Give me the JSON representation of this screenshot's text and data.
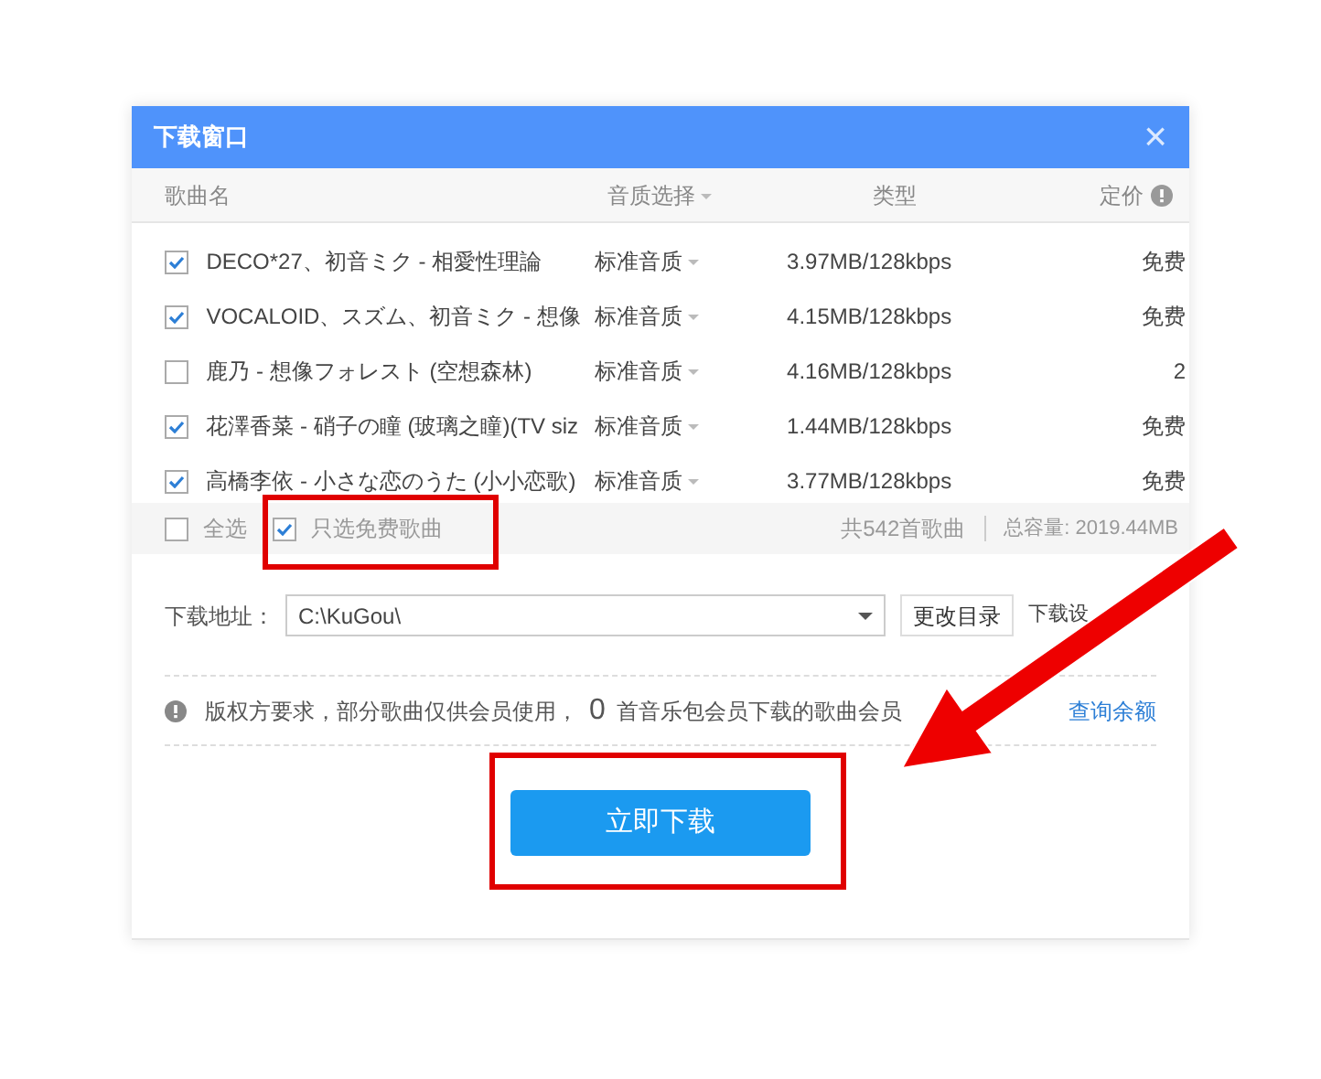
{
  "window": {
    "title": "下载窗口",
    "close": "×"
  },
  "columns": [
    "歌曲名",
    "音质选择",
    "类型",
    "定价"
  ],
  "songs": [
    {
      "title": "DECO*27、初音ミク - 相愛性理論",
      "quality": "标准音质",
      "type": "3.97MB/128kbps",
      "price": "免费",
      "checked": true
    },
    {
      "title": "VOCALOID、スズム、初音ミク - 想像",
      "quality": "标准音质",
      "type": "4.15MB/128kbps",
      "price": "免费",
      "checked": true
    },
    {
      "title": "鹿乃 - 想像フォレスト (空想森林)",
      "quality": "标准音质",
      "type": "4.16MB/128kbps",
      "price": "2",
      "checked": false
    },
    {
      "title": "花澤香菜 - 硝子の瞳 (玻璃之瞳)(TV siz",
      "quality": "标准音质",
      "type": "1.44MB/128kbps",
      "price": "免费",
      "checked": true
    },
    {
      "title": "高橋李依 - 小さな恋のうた (小小恋歌)",
      "quality": "标准音质",
      "type": "3.77MB/128kbps",
      "price": "免费",
      "checked": true
    }
  ],
  "footer": {
    "select_all": {
      "label": "全选",
      "checked": false
    },
    "free_only": {
      "label": "只选免费歌曲",
      "checked": true
    },
    "count": "共542首歌曲",
    "capacity": "总容量: 2019.44MB"
  },
  "download_path": {
    "label": "下载地址：",
    "value": "C:\\KuGou\\",
    "change_button": "更改目录",
    "settings_link": "下载设"
  },
  "notice": {
    "text": "版权方要求，部分歌曲仅供会员使用，",
    "count": "0",
    "text_after": "首音乐包会员下载的歌曲会员",
    "link": "查询余额"
  },
  "download_button": "立即下载"
}
